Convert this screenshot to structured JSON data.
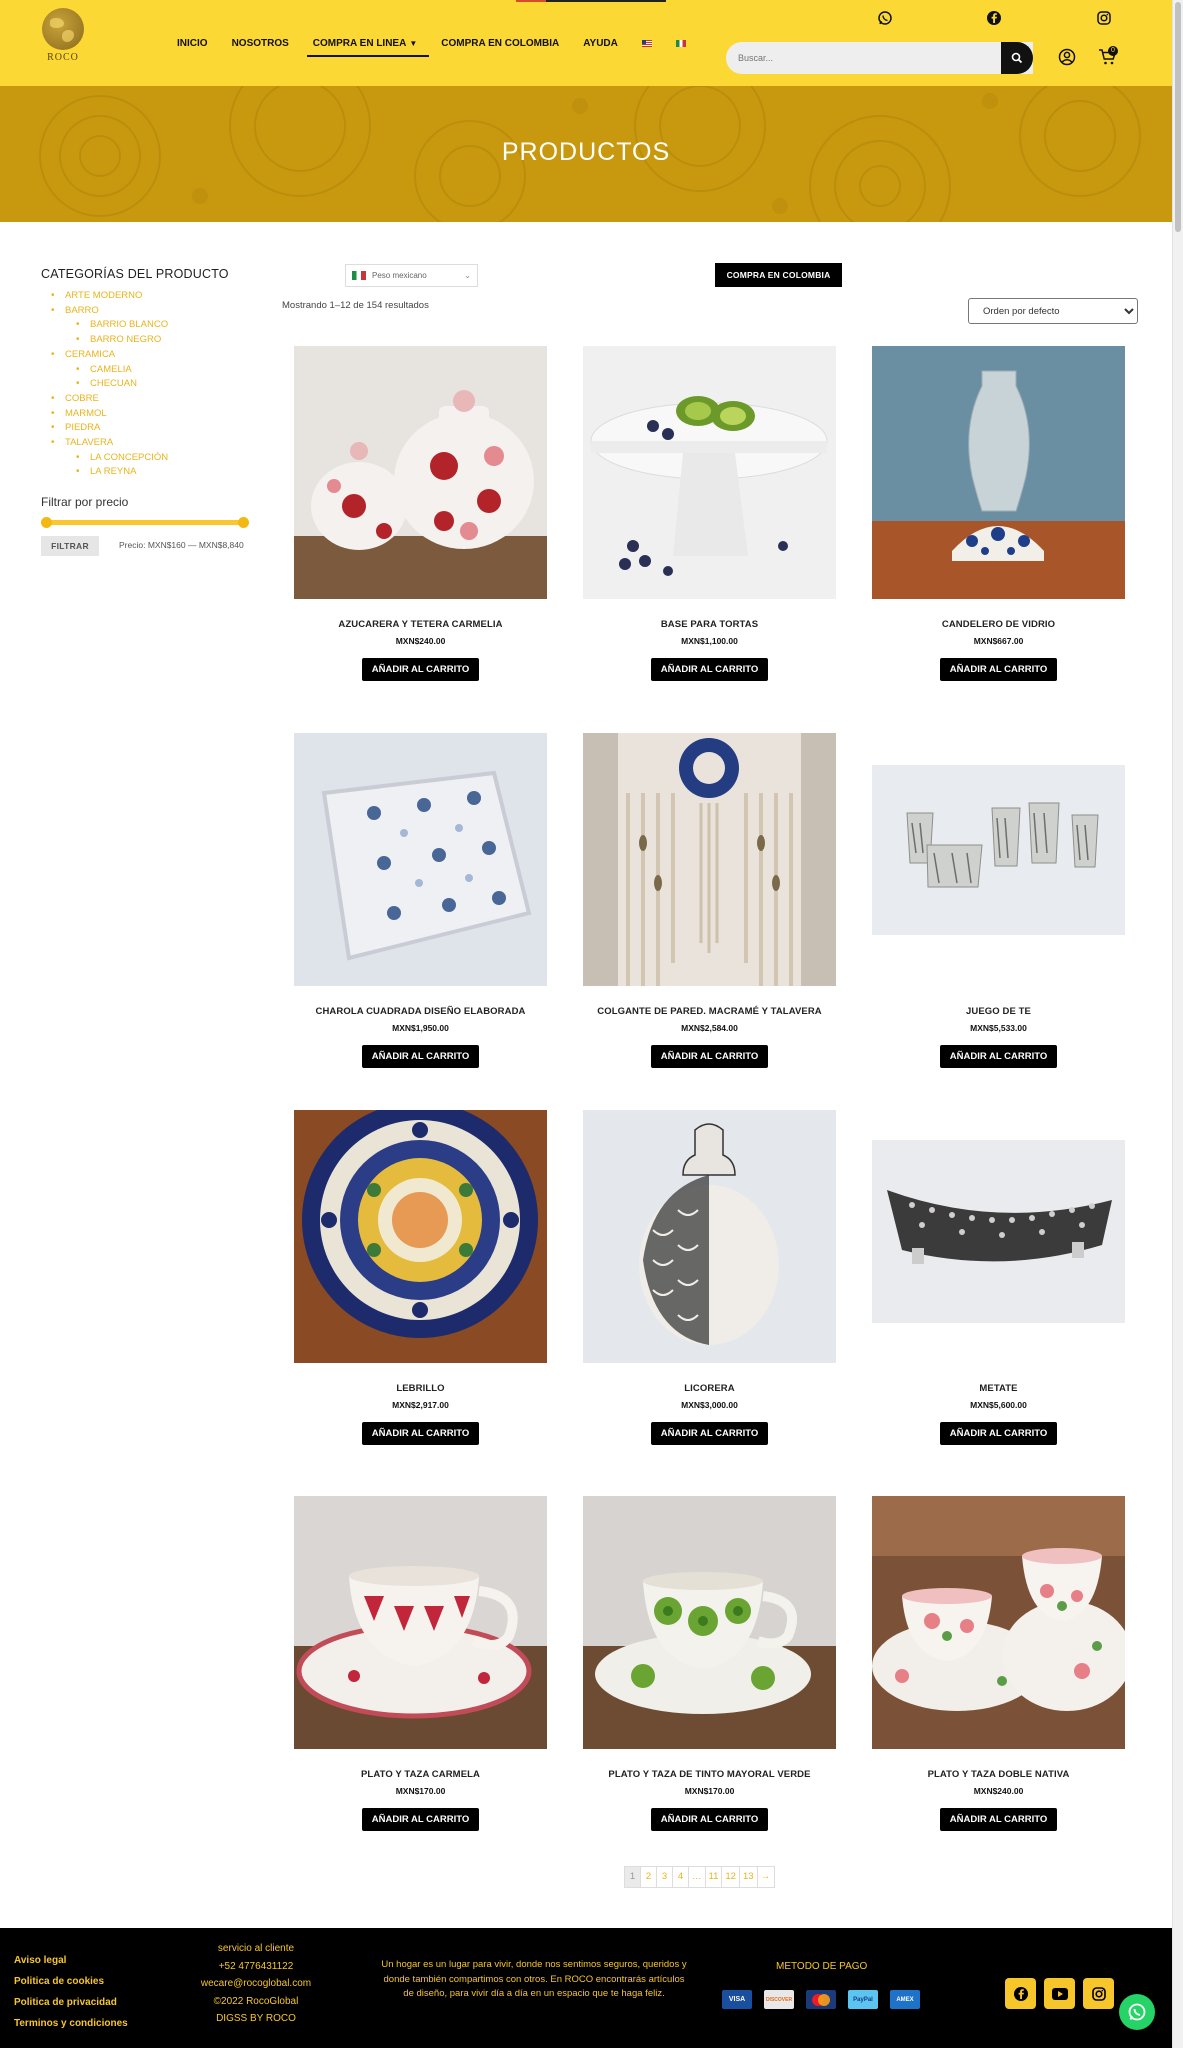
{
  "header": {
    "logo_text": "ROCO",
    "nav": [
      {
        "label": "INICIO"
      },
      {
        "label": "NOSOTROS"
      },
      {
        "label": "COMPRA EN LINEA"
      },
      {
        "label": "COMPRA EN COLOMBIA"
      },
      {
        "label": "AYUDA"
      }
    ],
    "search_placeholder": "Buscar...",
    "cart_count": "0"
  },
  "hero": {
    "title": "PRODUCTOS"
  },
  "sidebar": {
    "categories_title": "CATEGORÍAS DEL PRODUCTO",
    "categories": [
      {
        "label": "ARTE MODERNO",
        "level": 0
      },
      {
        "label": "BARRO",
        "level": 0
      },
      {
        "label": "BARRIO BLANCO",
        "level": 1
      },
      {
        "label": "BARRO NEGRO",
        "level": 1
      },
      {
        "label": "CERAMICA",
        "level": 0
      },
      {
        "label": "CAMELIA",
        "level": 1
      },
      {
        "label": "CHECUAN",
        "level": 1
      },
      {
        "label": "COBRE",
        "level": 0
      },
      {
        "label": "MARMOL",
        "level": 0
      },
      {
        "label": "PIEDRA",
        "level": 0
      },
      {
        "label": "TALAVERA",
        "level": 0
      },
      {
        "label": "LA CONCEPCIÓN",
        "level": 1
      },
      {
        "label": "LA REYNA",
        "level": 1
      }
    ],
    "price_filter_title": "Filtrar por precio",
    "filter_button": "FILTRAR",
    "price_range_label": "Precio: MXN$160 — MXN$8,840"
  },
  "toolbar": {
    "currency": "Peso mexicano",
    "colombia_button": "COMPRA EN COLOMBIA",
    "results_text": "Mostrando 1–12 de 154 resultados",
    "order_option": "Orden por defecto"
  },
  "products": [
    {
      "name": "AZUCARERA Y TETERA CARMELIA",
      "price": "MXN$240.00"
    },
    {
      "name": "BASE PARA TORTAS",
      "price": "MXN$1,100.00"
    },
    {
      "name": "CANDELERO DE VIDRIO",
      "price": "MXN$667.00"
    },
    {
      "name": "CHAROLA CUADRADA DISEÑO ELABORADA",
      "price": "MXN$1,950.00"
    },
    {
      "name": "COLGANTE DE PARED. MACRAMÉ Y TALAVERA",
      "price": "MXN$2,584.00"
    },
    {
      "name": "JUEGO DE TE",
      "price": "MXN$5,533.00"
    },
    {
      "name": "LEBRILLO",
      "price": "MXN$2,917.00"
    },
    {
      "name": "LICORERA",
      "price": "MXN$3,000.00"
    },
    {
      "name": "METATE",
      "price": "MXN$5,600.00"
    },
    {
      "name": "PLATO Y TAZA CARMELA",
      "price": "MXN$170.00"
    },
    {
      "name": "PLATO Y TAZA DE TINTO MAYORAL VERDE",
      "price": "MXN$170.00"
    },
    {
      "name": "PLATO Y TAZA DOBLE NATIVA",
      "price": "MXN$240.00"
    }
  ],
  "add_to_cart_label": "AÑADIR AL CARRITO",
  "pagination": [
    "1",
    "2",
    "3",
    "4",
    "…",
    "11",
    "12",
    "13",
    "→"
  ],
  "footer": {
    "links": [
      "Aviso legal",
      "Politica de cookies",
      "Politica de privacidad",
      "Terminos y condiciones"
    ],
    "contact": [
      "servicio al cliente",
      "+52 4776431122",
      "wecare@rocoglobal.com",
      "©2022 RocoGlobal",
      "DIGSS BY ROCO"
    ],
    "about": "Un hogar es un lugar para vivir, donde nos sentimos seguros, queridos y donde también compartimos con otros. En ROCO encontrarás artículos de diseño, para vivir día a día en un espacio que te haga feliz.",
    "payment_title": "METODO DE PAGO",
    "cards": [
      "VISA",
      "DISCOVER",
      "",
      "PayPal",
      "AMEX"
    ]
  },
  "colors": {
    "brand_yellow": "#fcd835",
    "hero_gold": "#c8990f",
    "link_yellow": "#e8b41c",
    "footer_bg": "#000000"
  }
}
